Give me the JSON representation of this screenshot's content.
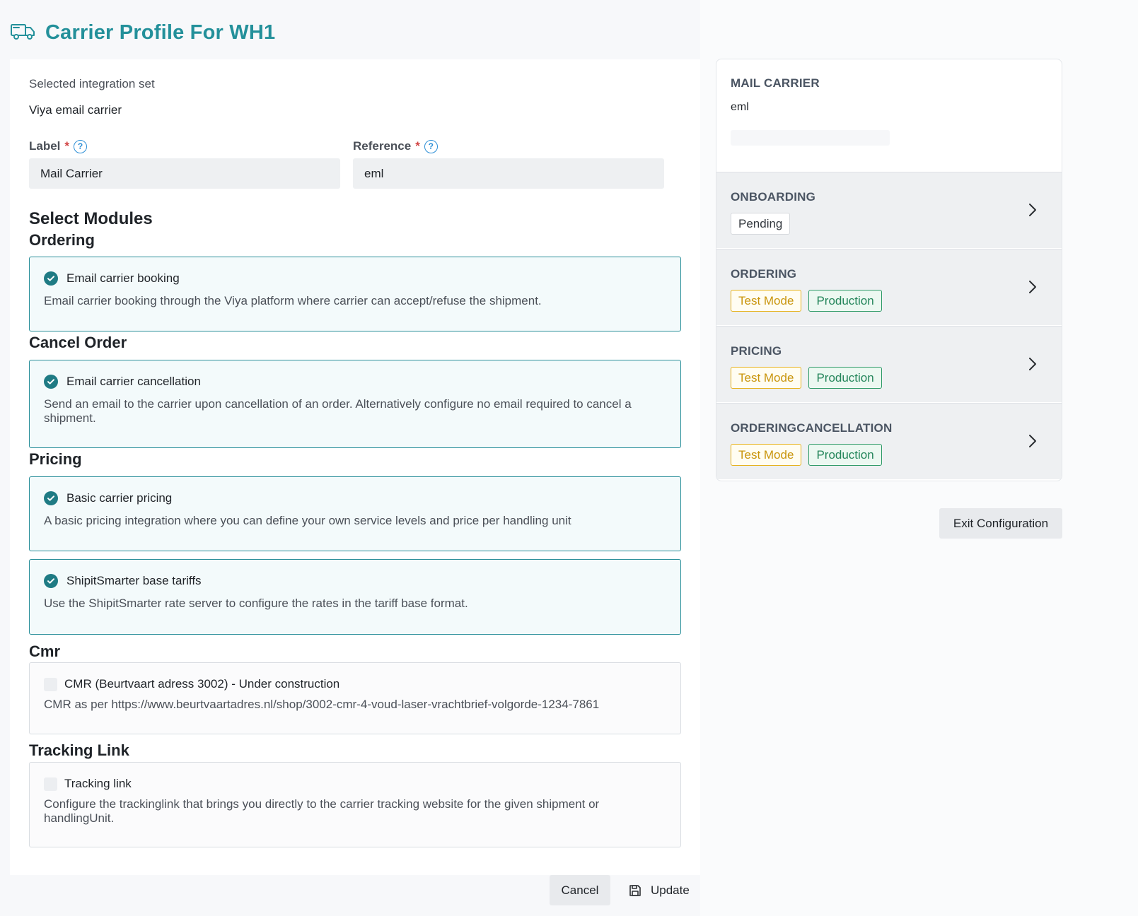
{
  "page": {
    "title": "Carrier Profile For WH1",
    "icon": "truck-icon",
    "accent_color": "#23909a"
  },
  "integration": {
    "label": "Selected integration set",
    "value": "Viya email carrier"
  },
  "fields": {
    "label": {
      "title": "Label",
      "required_mark": "*",
      "value": "Mail Carrier"
    },
    "reference": {
      "title": "Reference",
      "required_mark": "*",
      "value": "eml"
    }
  },
  "modules": {
    "heading": "Select Modules",
    "groups": [
      {
        "title": "Ordering",
        "items": [
          {
            "name": "Email carrier booking",
            "description": "Email carrier booking through the Viya platform where carrier can accept/refuse the shipment.",
            "checked": true
          }
        ]
      },
      {
        "title": "Cancel Order",
        "items": [
          {
            "name": "Email carrier cancellation",
            "description": "Send an email to the carrier upon cancellation of an order. Alternatively configure no email required to cancel a shipment.",
            "checked": true
          }
        ]
      },
      {
        "title": "Pricing",
        "items": [
          {
            "name": "Basic carrier pricing",
            "description": "A basic pricing integration where you can define your own service levels and price per handling unit",
            "checked": true
          },
          {
            "name": "ShipitSmarter base tariffs",
            "description": "Use the ShipitSmarter rate server to configure the rates in the tariff base format.",
            "checked": true
          }
        ]
      },
      {
        "title": "Cmr",
        "items": [
          {
            "name": "CMR (Beurtvaart adress 3002) - Under construction",
            "description": "CMR as per https://www.beurtvaartadres.nl/shop/3002-cmr-4-voud-laser-vrachtbrief-volgorde-1234-7861",
            "checked": false
          }
        ]
      },
      {
        "title": "Tracking Link",
        "items": [
          {
            "name": "Tracking link",
            "description": "Configure the trackinglink that brings you directly to the carrier tracking website for the given shipment or handlingUnit.",
            "checked": false
          }
        ]
      }
    ]
  },
  "sidebar": {
    "carrier_title": "MAIL CARRIER",
    "carrier_value": "eml",
    "sections": [
      {
        "title": "ONBOARDING",
        "tags": [
          "Pending"
        ]
      },
      {
        "title": "ORDERING",
        "tags": [
          "Test Mode",
          "Production"
        ]
      },
      {
        "title": "PRICING",
        "tags": [
          "Test Mode",
          "Production"
        ]
      },
      {
        "title": "ORDERINGCANCELLATION",
        "tags": [
          "Test Mode",
          "Production"
        ]
      }
    ],
    "status_colors": {
      "test_mode": "#e6b21c",
      "production": "#2e9a67"
    }
  },
  "actions": {
    "exit": "Exit Configuration",
    "cancel": "Cancel",
    "update": "Update"
  }
}
